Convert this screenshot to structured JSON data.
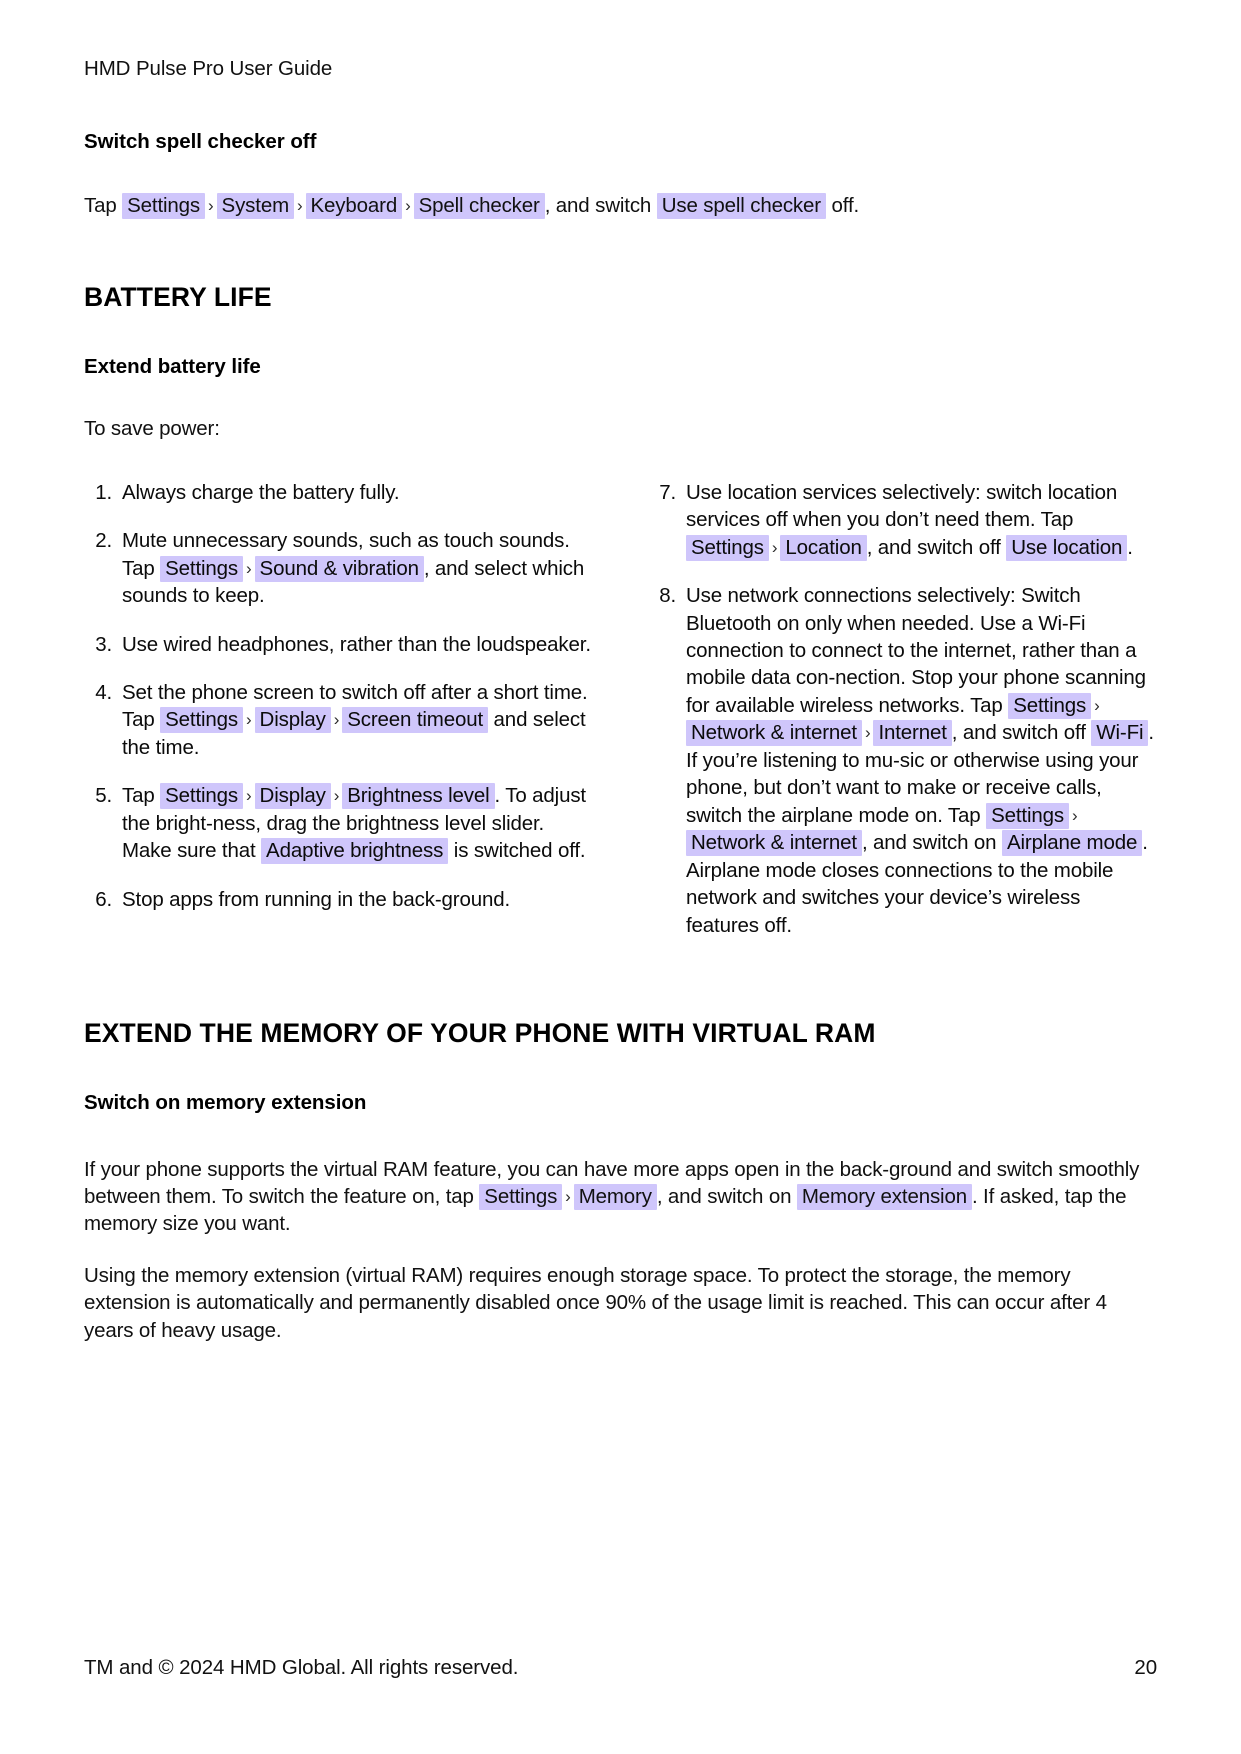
{
  "document": {
    "running_head": "HMD Pulse Pro User Guide",
    "page_number": "20",
    "footer_copyright": "TM and © 2024 HMD Global. All rights reserved.",
    "highlight_color": "#cfc6fb",
    "text_color": "#111111",
    "background_color": "#ffffff"
  },
  "spell_checker": {
    "heading": "Switch spell checker off",
    "text_1": "Tap",
    "chip_settings": "Settings",
    "chip_system": "System",
    "chip_keyboard": "Keyboard",
    "chip_spell_checker": "Spell checker",
    "text_2": ", and switch",
    "chip_use_spell_checker": "Use spell checker",
    "text_3": "off.",
    "separator": "›"
  },
  "battery_life": {
    "title": "BATTERY LIFE",
    "sub_head": "Extend battery life",
    "intro": "To save power:",
    "steps_left": [
      {
        "num": "1.",
        "parts": [
          {
            "type": "text",
            "value": "Always charge the battery fully."
          }
        ]
      },
      {
        "num": "2.",
        "parts": [
          {
            "type": "text",
            "value": "Mute unnecessary sounds, such as touch sounds. Tap "
          },
          {
            "type": "chip",
            "value": "Settings"
          },
          {
            "type": "sep",
            "value": "›"
          },
          {
            "type": "chip",
            "value": "Sound & vibration"
          },
          {
            "type": "text",
            "value": ", and select which sounds to keep."
          }
        ]
      },
      {
        "num": "3.",
        "parts": [
          {
            "type": "text",
            "value": "Use wired headphones, rather than the loudspeaker."
          }
        ]
      },
      {
        "num": "4.",
        "parts": [
          {
            "type": "text",
            "value": "Set the phone screen to switch off after a short time. Tap "
          },
          {
            "type": "chip",
            "value": "Settings"
          },
          {
            "type": "sep",
            "value": "›"
          },
          {
            "type": "chip",
            "value": "Display"
          },
          {
            "type": "sep",
            "value": "›"
          },
          {
            "type": "chip",
            "value": "Screen timeout"
          },
          {
            "type": "text",
            "value": " and select the time."
          }
        ]
      },
      {
        "num": "5.",
        "parts": [
          {
            "type": "text",
            "value": "Tap "
          },
          {
            "type": "chip",
            "value": "Settings"
          },
          {
            "type": "sep",
            "value": "›"
          },
          {
            "type": "chip",
            "value": "Display"
          },
          {
            "type": "sep",
            "value": "›"
          },
          {
            "type": "chip",
            "value": "Brightness level"
          },
          {
            "type": "text",
            "value": ". To adjust the bright-ness, drag the brightness level slider. Make sure that "
          },
          {
            "type": "chip",
            "value": "Adaptive brightness"
          },
          {
            "type": "text",
            "value": " is switched off."
          }
        ]
      },
      {
        "num": "6.",
        "parts": [
          {
            "type": "text",
            "value": "Stop apps from running in the back-ground."
          }
        ]
      }
    ],
    "steps_right": [
      {
        "num": "7.",
        "parts": [
          {
            "type": "text",
            "value": "Use location services selectively: switch location services off when you don’t need them. Tap "
          },
          {
            "type": "chip",
            "value": "Settings"
          },
          {
            "type": "sep",
            "value": "›"
          },
          {
            "type": "chip",
            "value": "Location"
          },
          {
            "type": "text",
            "value": ", and switch off "
          },
          {
            "type": "chip",
            "value": "Use location"
          },
          {
            "type": "text",
            "value": "."
          }
        ]
      },
      {
        "num": "8.",
        "parts": [
          {
            "type": "text",
            "value": "Use network connections selectively: Switch Bluetooth on only when needed. Use a Wi-Fi connection to connect to the internet, rather than a mobile data con-nection. Stop your phone scanning for available wireless networks. Tap "
          },
          {
            "type": "chip",
            "value": "Settings"
          },
          {
            "type": "sep",
            "value": "›"
          },
          {
            "type": "chip",
            "value": "Network & internet"
          },
          {
            "type": "sep",
            "value": "›"
          },
          {
            "type": "chip",
            "value": "Internet"
          },
          {
            "type": "text",
            "value": ", and switch off "
          },
          {
            "type": "chip",
            "value": "Wi-Fi"
          },
          {
            "type": "text",
            "value": ". If you’re listening to mu-sic or otherwise using your phone, but don’t want to make or receive calls, switch the airplane mode on. Tap "
          },
          {
            "type": "chip",
            "value": "Settings"
          },
          {
            "type": "sep",
            "value": "›"
          },
          {
            "type": "chip",
            "value": "Network & internet"
          },
          {
            "type": "text",
            "value": ", and switch on "
          },
          {
            "type": "chip",
            "value": "Airplane mode"
          },
          {
            "type": "text",
            "value": ". Airplane mode closes connections to the mobile network and switches your device’s wireless features off."
          }
        ]
      }
    ]
  },
  "virtual_ram": {
    "title": "EXTEND THE MEMORY OF YOUR PHONE WITH VIRTUAL RAM",
    "sub_head": "Switch on memory extension",
    "paragraph_1": [
      {
        "type": "text",
        "value": "If your phone supports the virtual RAM feature, you can have more apps open in the back-ground and switch smoothly between them. To switch the feature on, tap "
      },
      {
        "type": "chip",
        "value": "Settings"
      },
      {
        "type": "sep",
        "value": "›"
      },
      {
        "type": "chip",
        "value": "Memory"
      },
      {
        "type": "text",
        "value": ", and switch on "
      },
      {
        "type": "chip",
        "value": "Memory extension"
      },
      {
        "type": "text",
        "value": ". If asked, tap the memory size you want."
      }
    ],
    "paragraph_2": "Using the memory extension (virtual RAM) requires enough storage space. To protect the storage, the memory extension is automatically and permanently disabled once 90% of the usage limit is reached. This can occur after 4 years of heavy usage."
  }
}
